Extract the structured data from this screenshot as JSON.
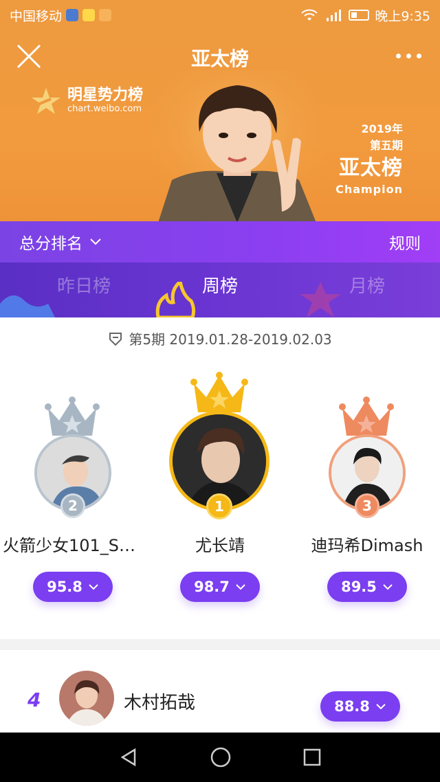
{
  "status_bar": {
    "carrier": "中国移动",
    "time": "晚上9:35"
  },
  "header": {
    "title": "亚太榜",
    "logo_cn": "明星势力榜",
    "logo_url": "chart.weibo.com",
    "champion_year": "2019年",
    "champion_issue": "第五期",
    "champion_board": "亚太榜",
    "champion_en": "Champion"
  },
  "sort_bar": {
    "sort_label": "总分排名",
    "rules_label": "规则"
  },
  "tabs": [
    {
      "label": "昨日榜",
      "active": false
    },
    {
      "label": "周榜",
      "active": true
    },
    {
      "label": "月榜",
      "active": false
    }
  ],
  "period": {
    "text": "第5期 2019.01.28-2019.02.03"
  },
  "podium": {
    "first": {
      "rank": "1",
      "name": "尤长靖",
      "score": "98.7"
    },
    "second": {
      "rank": "2",
      "name": "火箭少女101_S…",
      "score": "95.8"
    },
    "third": {
      "rank": "3",
      "name": "迪玛希Dimash",
      "score": "89.5"
    }
  },
  "list": [
    {
      "rank": "4",
      "name": "木村拓哉",
      "score": "88.8"
    }
  ],
  "colors": {
    "banner": "#ee9a3f",
    "accent": "#7b3ef0",
    "gold": "#f5b817",
    "silver": "#a8b6c3",
    "bronze": "#ee8a5f"
  }
}
